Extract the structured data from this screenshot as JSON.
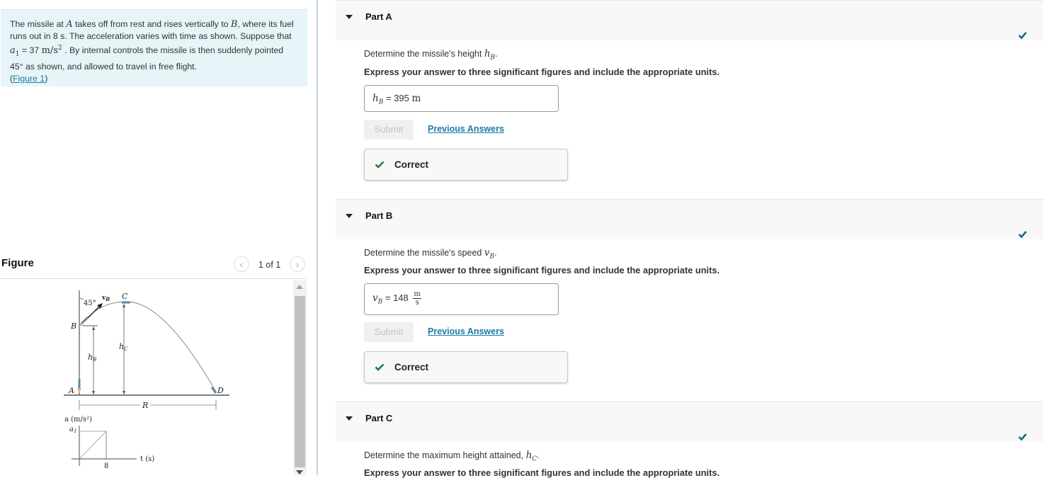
{
  "problem": {
    "text_1": "The missile at ",
    "var_A": "A",
    "text_2": " takes off from rest and rises vertically to ",
    "var_B": "B",
    "text_3": ", where its fuel runs out in 8 s. The acceleration varies with time as shown. Suppose that ",
    "var_a1": "a",
    "var_a1_sub": "1",
    "text_4": " = 37 ",
    "unit_a1": "m/s",
    "unit_a1_sup": "2",
    "text_5": " . By internal controls the missile is then suddenly pointed 45° as shown, and allowed to travel in free flight.",
    "figure_link_open": "(",
    "figure_link": "Figure 1",
    "figure_link_close": ")"
  },
  "figure": {
    "title": "Figure",
    "prev_icon": "chevron-left-icon",
    "next_icon": "chevron-right-icon",
    "page_indicator": "1 of 1",
    "labels": {
      "angle": "45°",
      "vB": "v",
      "vB_sub": "B",
      "C": "C",
      "B": "B",
      "hC": "h",
      "hC_sub": "C",
      "hB": "h",
      "hB_sub": "B",
      "A": "A",
      "D": "D",
      "R": "R",
      "a_axis": "a (m/s²)",
      "a1": "a",
      "a1_sub": "1",
      "t_axis": "t (s)",
      "t_tick": "8"
    }
  },
  "parts": [
    {
      "label": "Part A",
      "status": "correct",
      "question_prefix": "Determine the missile's height ",
      "question_var": "h",
      "question_var_sub": "B",
      "question_suffix": ".",
      "instruction": "Express your answer to three significant figures and include the appropriate units.",
      "answer_var": "h",
      "answer_var_sub": "B",
      "answer_eq": " = ",
      "answer_value": "395",
      "answer_unit": "m",
      "submit_label": "Submit",
      "previous_answers_label": "Previous Answers",
      "feedback": "Correct"
    },
    {
      "label": "Part B",
      "status": "correct",
      "question_prefix": "Determine the missile's speed ",
      "question_var": "v",
      "question_var_sub": "B",
      "question_suffix": ".",
      "instruction": "Express your answer to three significant figures and include the appropriate units.",
      "answer_var": "v",
      "answer_var_sub": "B",
      "answer_eq": " = ",
      "answer_value": "148",
      "answer_unit_num": "m",
      "answer_unit_den": "s",
      "submit_label": "Submit",
      "previous_answers_label": "Previous Answers",
      "feedback": "Correct"
    },
    {
      "label": "Part C",
      "status": "correct",
      "question_prefix": "Determine the maximum height attained, ",
      "question_var": "h",
      "question_var_sub": "C",
      "question_suffix": ".",
      "instruction": "Express your answer to three significant figures and include the appropriate units."
    }
  ],
  "colors": {
    "problem_bg": "#e6f5f7",
    "link": "#1a7aa8",
    "status_check": "#0e6a8a",
    "correct_check": "#1b7f3a"
  }
}
